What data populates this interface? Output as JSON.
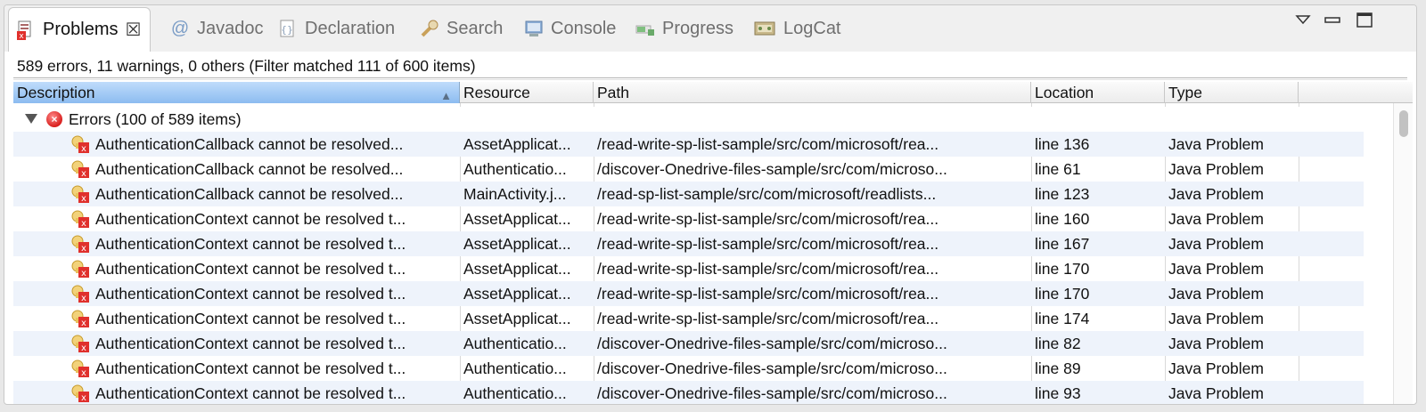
{
  "tabs": [
    {
      "label": "Problems",
      "icon": "problems-icon",
      "active": true
    },
    {
      "label": "Javadoc",
      "icon": "javadoc-icon"
    },
    {
      "label": "Declaration",
      "icon": "declaration-icon"
    },
    {
      "label": "Search",
      "icon": "search-icon"
    },
    {
      "label": "Console",
      "icon": "console-icon"
    },
    {
      "label": "Progress",
      "icon": "progress-icon"
    },
    {
      "label": "LogCat",
      "icon": "logcat-icon"
    }
  ],
  "tab_close_glyph": "☒",
  "summary": "589 errors, 11 warnings, 0 others (Filter matched 111 of 600 items)",
  "columns": [
    "Description",
    "Resource",
    "Path",
    "Location",
    "Type"
  ],
  "group": {
    "label": "Errors (100 of 589 items)"
  },
  "rows": [
    {
      "description": "AuthenticationCallback cannot be resolved...",
      "resource": "AssetApplicat...",
      "path": "/read-write-sp-list-sample/src/com/microsoft/rea...",
      "location": "line 136",
      "type": "Java Problem"
    },
    {
      "description": "AuthenticationCallback cannot be resolved...",
      "resource": "Authenticatio...",
      "path": "/discover-Onedrive-files-sample/src/com/microso...",
      "location": "line 61",
      "type": "Java Problem"
    },
    {
      "description": "AuthenticationCallback cannot be resolved...",
      "resource": "MainActivity.j...",
      "path": "/read-sp-list-sample/src/com/microsoft/readlists...",
      "location": "line 123",
      "type": "Java Problem"
    },
    {
      "description": "AuthenticationContext cannot be resolved t...",
      "resource": "AssetApplicat...",
      "path": "/read-write-sp-list-sample/src/com/microsoft/rea...",
      "location": "line 160",
      "type": "Java Problem"
    },
    {
      "description": "AuthenticationContext cannot be resolved t...",
      "resource": "AssetApplicat...",
      "path": "/read-write-sp-list-sample/src/com/microsoft/rea...",
      "location": "line 167",
      "type": "Java Problem"
    },
    {
      "description": "AuthenticationContext cannot be resolved t...",
      "resource": "AssetApplicat...",
      "path": "/read-write-sp-list-sample/src/com/microsoft/rea...",
      "location": "line 170",
      "type": "Java Problem"
    },
    {
      "description": "AuthenticationContext cannot be resolved t...",
      "resource": "AssetApplicat...",
      "path": "/read-write-sp-list-sample/src/com/microsoft/rea...",
      "location": "line 170",
      "type": "Java Problem"
    },
    {
      "description": "AuthenticationContext cannot be resolved t...",
      "resource": "AssetApplicat...",
      "path": "/read-write-sp-list-sample/src/com/microsoft/rea...",
      "location": "line 174",
      "type": "Java Problem"
    },
    {
      "description": "AuthenticationContext cannot be resolved t...",
      "resource": "Authenticatio...",
      "path": "/discover-Onedrive-files-sample/src/com/microso...",
      "location": "line 82",
      "type": "Java Problem"
    },
    {
      "description": "AuthenticationContext cannot be resolved t...",
      "resource": "Authenticatio...",
      "path": "/discover-Onedrive-files-sample/src/com/microso...",
      "location": "line 89",
      "type": "Java Problem"
    },
    {
      "description": "AuthenticationContext cannot be resolved t...",
      "resource": "Authenticatio...",
      "path": "/discover-Onedrive-files-sample/src/com/microso...",
      "location": "line 93",
      "type": "Java Problem"
    }
  ],
  "colors": {
    "selected_header": "#8cbcf0",
    "row_alt": "#eef3fb",
    "error_red": "#d9201e"
  }
}
